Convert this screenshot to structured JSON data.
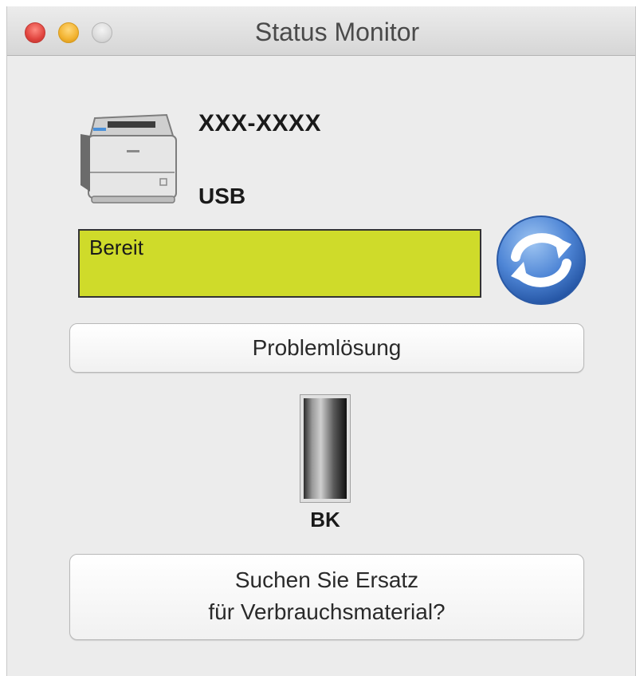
{
  "window": {
    "title": "Status Monitor"
  },
  "device": {
    "name": "XXX-XXXX",
    "connection": "USB",
    "icon": "printer-icon"
  },
  "status": {
    "text": "Bereit",
    "color": "#cfdb2a",
    "refresh_icon": "refresh-icon"
  },
  "buttons": {
    "troubleshoot_label": "Problemlösung",
    "supplies_line1": "Suchen Sie Ersatz",
    "supplies_line2": "für Verbrauchsmaterial?"
  },
  "toner": {
    "label": "BK",
    "level": 1.0
  }
}
